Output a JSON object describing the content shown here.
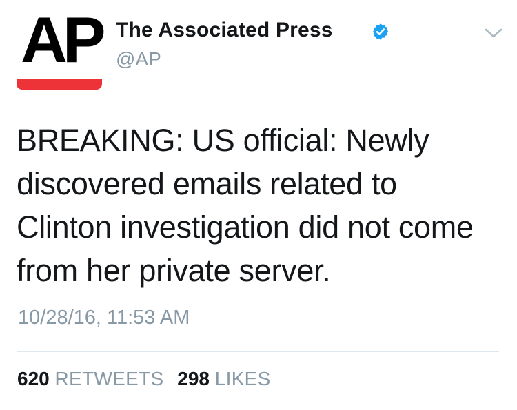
{
  "author": {
    "avatar_text": "AP",
    "display_name": "The Associated Press",
    "handle": "@AP",
    "verified": true,
    "avatar_accent_color": "#ee3338",
    "verified_color": "#1da1f2"
  },
  "menu": {
    "icon": "chevron-down-icon"
  },
  "tweet": {
    "text": "BREAKING: US official: Newly discovered emails related to Clinton investigation did not come from her private server.",
    "timestamp": "10/28/16, 11:53 AM"
  },
  "stats": {
    "retweets_count": "620",
    "retweets_label": "RETWEETS",
    "likes_count": "298",
    "likes_label": "LIKES"
  }
}
